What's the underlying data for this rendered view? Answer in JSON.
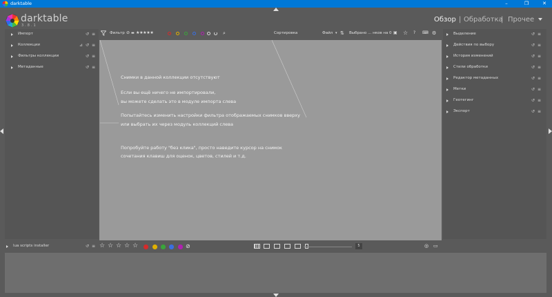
{
  "window": {
    "title": "darktable",
    "controls": [
      "–",
      "❐",
      "✕"
    ]
  },
  "logo": {
    "text": "darktable",
    "version": "3.8.1"
  },
  "views": {
    "items": [
      {
        "label": "Обзор",
        "active": true
      },
      {
        "label": "Обработка",
        "active": false
      },
      {
        "label": "Прочее",
        "active": false
      }
    ],
    "separator": "|"
  },
  "left_panel": {
    "modules": [
      {
        "label": "Импорт"
      },
      {
        "label": "Коллекции"
      },
      {
        "label": "Фильтры коллекции"
      },
      {
        "label": "Метаданные"
      }
    ],
    "bottom_module": {
      "label": "lua scripts installer"
    }
  },
  "right_panel": {
    "modules": [
      {
        "label": "Выделение"
      },
      {
        "label": "Действия по выбору"
      },
      {
        "label": "История изменений"
      },
      {
        "label": "Стили обработки"
      },
      {
        "label": "Редактор метаданных"
      },
      {
        "label": "Метки"
      },
      {
        "label": "Геотегинг"
      },
      {
        "label": "Экспорт"
      }
    ]
  },
  "top_toolbar": {
    "filter_label": "Фильтр",
    "rating_stars": "★★★★★",
    "sort_label": "Сортировка",
    "sort_value": "Файл",
    "selected_text": "Выбрано ... нков на 0"
  },
  "colors": {
    "label_colors": [
      "#d42b2b",
      "#e0b000",
      "#3aa53a",
      "#3a6fe0",
      "#b020b0"
    ]
  },
  "center_message": {
    "line1": "Снимки в данной коллекции отсутствуют",
    "line2": "Если вы ещё ничего не импортировали,",
    "line3": "вы можете сделать это в модуле импорта слева",
    "line4": "Попытайтесь изменить настройки фильтра отображаемых снимков вверху",
    "line5": "или выбрать их через модуль коллекций слева",
    "line6": "Попробуйте работу \"без клика\", просто наведите курсор на снимок",
    "line7": "сочетания клавиш для оценок, цветов, стилей и т.д."
  },
  "bottom_toolbar": {
    "stars": [
      "☆",
      "☆",
      "☆",
      "☆",
      "☆"
    ],
    "zoom_value": "5"
  }
}
